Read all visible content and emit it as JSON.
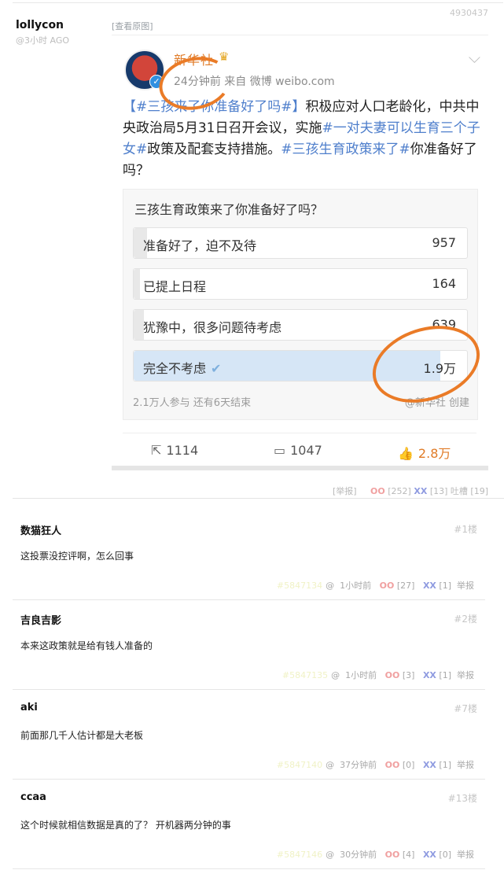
{
  "post": {
    "author": "lollycon",
    "time": "@3小时 AGO",
    "id": "4930437",
    "view_original": "[查看原图]"
  },
  "weibo": {
    "source_name": "新华社",
    "source_time": "24分钟前  来自 微博 weibo.com",
    "body_segments": [
      {
        "text": "【#三孩来了你准备好了吗#】",
        "tag": true
      },
      {
        "text": "积极应对人口老龄化，中共中央政治局5月31日召开会议，实施",
        "tag": false
      },
      {
        "text": "#一对夫妻可以生育三个子女#",
        "tag": true
      },
      {
        "text": "政策及配套支持措施。",
        "tag": false
      },
      {
        "text": "#三孩生育政策来了#",
        "tag": true
      },
      {
        "text": "你准备好了吗？",
        "tag": false
      }
    ],
    "poll": {
      "title": "三孩生育政策来了你准备好了吗？",
      "options": [
        {
          "label": "准备好了，迫不及待",
          "count": "957",
          "fraction": 0.04,
          "selected": false
        },
        {
          "label": "已提上日程",
          "count": "164",
          "fraction": 0.01,
          "selected": false
        },
        {
          "label": "犹豫中，很多问题待考虑",
          "count": "639",
          "fraction": 0.03,
          "selected": false
        },
        {
          "label": "完全不考虑",
          "count": "1.9万",
          "fraction": 0.92,
          "selected": true
        }
      ],
      "footer": "2.1万人参与  还有6天结束",
      "brand": "@新华社 创建"
    },
    "actions": {
      "share": "1114",
      "comment": "1047",
      "like": "2.8万"
    },
    "accent_color": "#e07b27",
    "annotation_color": "#ea7b27"
  },
  "report_bar": {
    "report": "[举报]",
    "oo_label": "OO",
    "oo_count": "[252]",
    "xx_label": "XX",
    "xx_count": "[13]",
    "tucao_label": "吐槽",
    "tucao_count": "[19]"
  },
  "comments": [
    {
      "user": "数猫狂人",
      "floor": "#1楼",
      "text": "这投票没控评啊，怎么回事",
      "hash": "#5847134",
      "time": "1小时前",
      "oo": "[27]",
      "xx": "[1]",
      "report": "举报"
    },
    {
      "user": "吉良吉影",
      "floor": "#2楼",
      "text": "本来这政策就是给有钱人准备的",
      "hash": "#5847135",
      "time": "1小时前",
      "oo": "[3]",
      "xx": "[1]",
      "report": "举报"
    },
    {
      "user": "aki",
      "floor": "#7楼",
      "text": "前面那几千人估计都是大老板",
      "hash": "#5847140",
      "time": "37分钟前",
      "oo": "[0]",
      "xx": "[1]",
      "report": "举报"
    },
    {
      "user": "ccaa",
      "floor": "#13楼",
      "text": "这个时候就相信数据是真的了？ 开机器两分钟的事",
      "hash": "#5847146",
      "time": "30分钟前",
      "oo": "[4]",
      "xx": "[0]",
      "report": "举报"
    }
  ]
}
